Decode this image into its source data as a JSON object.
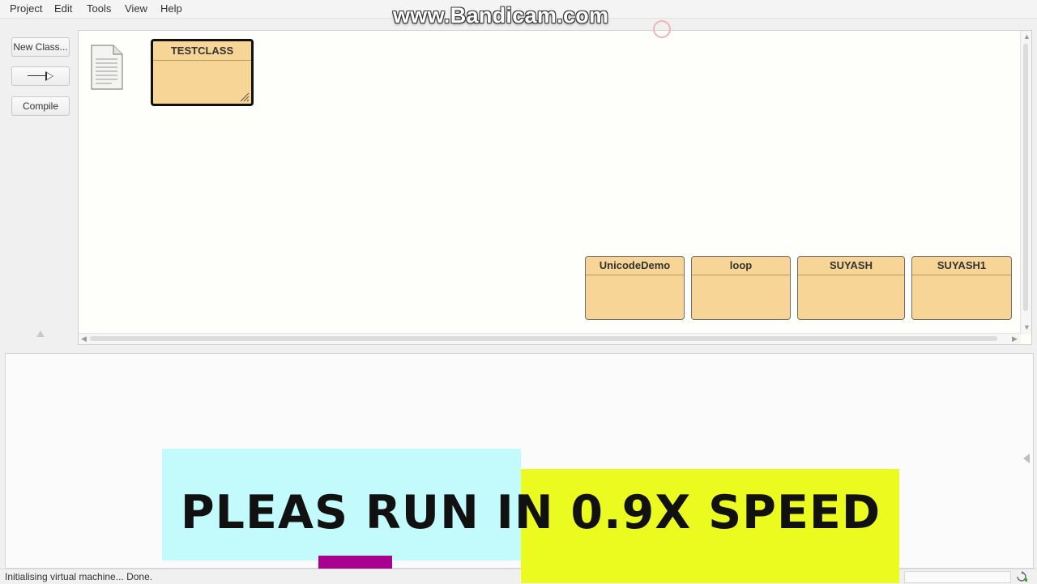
{
  "menu": {
    "items": [
      {
        "label": "Project"
      },
      {
        "label": "Edit"
      },
      {
        "label": "Tools"
      },
      {
        "label": "View"
      },
      {
        "label": "Help"
      }
    ]
  },
  "toolbar": {
    "new_class_label": "New Class...",
    "arrow_icon": "inheritance-arrow-icon",
    "compile_label": "Compile"
  },
  "diagram": {
    "readme_icon": "readme-document-icon",
    "selected_class": "TESTCLASS",
    "classes": [
      {
        "name": "UnicodeDemo"
      },
      {
        "name": "loop"
      },
      {
        "name": "SUYASH"
      },
      {
        "name": "SUYASH1"
      }
    ]
  },
  "status": {
    "text": "Initialising virtual machine... Done."
  },
  "overlay": {
    "watermark": "www.Bandicam.com",
    "banner_text": "PLEAS RUN IN 0.9X SPEED",
    "colors": {
      "banner_cyan": "#c3fbfc",
      "banner_yellow": "#ebfa1f",
      "banner_bar": "#a8008f",
      "class_fill": "#f7d596"
    }
  }
}
